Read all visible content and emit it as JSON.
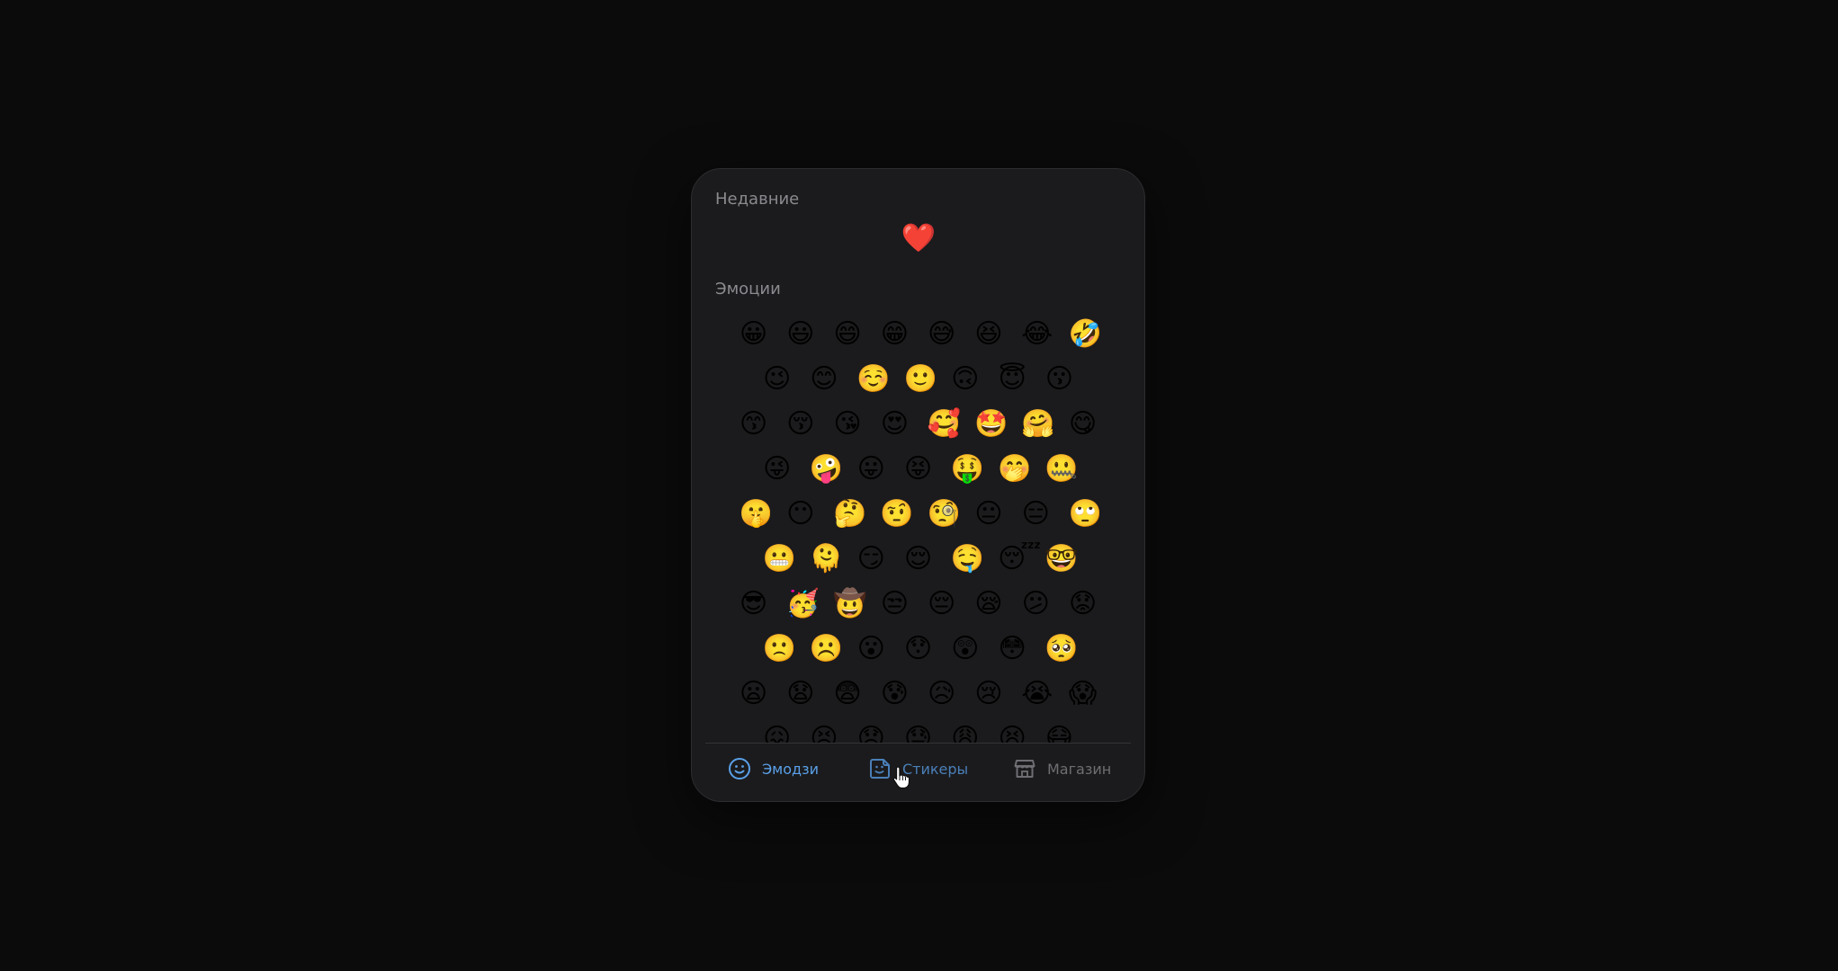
{
  "recent": {
    "title": "Недавние",
    "emojis": [
      "❤️"
    ]
  },
  "emotions": {
    "title": "Эмоции",
    "rows": [
      [
        "😀",
        "😃",
        "😄",
        "😁",
        "😅",
        "😆",
        "😂",
        "🤣"
      ],
      [
        "😉",
        "😊",
        "☺️",
        "🙂",
        "🙃",
        "😇",
        "😗"
      ],
      [
        "😙",
        "😚",
        "😘",
        "😍",
        "🥰",
        "🤩",
        "🤗",
        "😋"
      ],
      [
        "😜",
        "🤪",
        "😛",
        "😝",
        "🤑",
        "🤭",
        "🤐"
      ],
      [
        "🤫",
        "😶",
        "🤔",
        "🤨",
        "🧐",
        "😐",
        "😑",
        "🙄"
      ],
      [
        "😬",
        "🫠",
        "😏",
        "😌",
        "🤤",
        "😴",
        "🤓"
      ],
      [
        "😎",
        "🥳",
        "🤠",
        "😒",
        "😔",
        "😪",
        "😕",
        "😟"
      ],
      [
        "🙁",
        "☹️",
        "😮",
        "😯",
        "😲",
        "😳",
        "🥺"
      ],
      [
        "😦",
        "😧",
        "😨",
        "😰",
        "😥",
        "😢",
        "😭",
        "😱"
      ],
      [
        "😖",
        "😣",
        "😞",
        "😓",
        "😩",
        "😫",
        "😷"
      ]
    ]
  },
  "tabs": {
    "emoji": {
      "label": "Эмодзи",
      "icon": "smiley-icon",
      "color": "#5aa0e8"
    },
    "stickers": {
      "label": "Стикеры",
      "icon": "sticker-icon",
      "color": "#4a7fb8"
    },
    "store": {
      "label": "Магазин",
      "icon": "store-icon",
      "color": "#6e6e73"
    }
  },
  "colors": {
    "background": "#0b0b0c",
    "panel": "#1b1b1d",
    "section_title": "#8a8a8f",
    "accent": "#5aa0e8"
  }
}
